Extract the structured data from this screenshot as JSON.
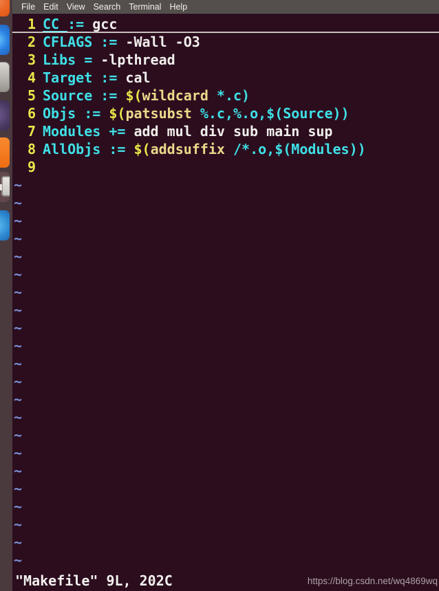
{
  "window": {
    "title": "Makefile - Terminal",
    "background_color": "#2b0d1e",
    "menubar_color": "#544f4c",
    "launcher_color": "#4a3a3e"
  },
  "menubar": {
    "items": [
      {
        "label": "File"
      },
      {
        "label": "Edit"
      },
      {
        "label": "View"
      },
      {
        "label": "Search"
      },
      {
        "label": "Terminal"
      },
      {
        "label": "Help"
      }
    ]
  },
  "launcher": {
    "icons": [
      {
        "name": "ubuntu-dash-icon"
      },
      {
        "name": "firefox-icon"
      },
      {
        "name": "files-icon"
      },
      {
        "name": "software-center-icon"
      },
      {
        "name": "libreoffice-icon"
      },
      {
        "name": "terminal-icon"
      },
      {
        "name": "settings-icon"
      }
    ]
  },
  "editor": {
    "filename": "Makefile",
    "colors": {
      "lineno": "#e8e84a",
      "variable": "#3fe0e6",
      "value": "#f2efec",
      "function_paren": "#e8e84a",
      "function_name": "#ecd98a",
      "tilde": "#7a8fd6"
    },
    "lines": [
      {
        "number": "1",
        "cursorline": true,
        "tokens": [
          {
            "type": "var",
            "text": "CC "
          },
          {
            "type": "op",
            "text": ":="
          },
          {
            "type": "plain",
            "text": " gcc"
          }
        ]
      },
      {
        "number": "2",
        "cursorline": false,
        "tokens": [
          {
            "type": "var",
            "text": "CFLAGS"
          },
          {
            "type": "plain",
            "text": " "
          },
          {
            "type": "op",
            "text": ":="
          },
          {
            "type": "plain",
            "text": " -Wall -O3"
          }
        ]
      },
      {
        "number": "3",
        "cursorline": false,
        "tokens": [
          {
            "type": "var",
            "text": "Libs"
          },
          {
            "type": "plain",
            "text": " "
          },
          {
            "type": "op",
            "text": "="
          },
          {
            "type": "plain",
            "text": " -lpthread"
          }
        ]
      },
      {
        "number": "4",
        "cursorline": false,
        "tokens": [
          {
            "type": "var",
            "text": "Target"
          },
          {
            "type": "plain",
            "text": " "
          },
          {
            "type": "op",
            "text": ":="
          },
          {
            "type": "plain",
            "text": " cal"
          }
        ]
      },
      {
        "number": "5",
        "cursorline": false,
        "tokens": [
          {
            "type": "var",
            "text": "Source"
          },
          {
            "type": "plain",
            "text": " "
          },
          {
            "type": "op",
            "text": ":="
          },
          {
            "type": "plain",
            "text": " "
          },
          {
            "type": "func",
            "text": "$("
          },
          {
            "type": "fname",
            "text": "wildcard"
          },
          {
            "type": "args",
            "text": " *.c)"
          }
        ]
      },
      {
        "number": "6",
        "cursorline": false,
        "tokens": [
          {
            "type": "var",
            "text": "Objs"
          },
          {
            "type": "plain",
            "text": " "
          },
          {
            "type": "op",
            "text": ":="
          },
          {
            "type": "plain",
            "text": " "
          },
          {
            "type": "func",
            "text": "$("
          },
          {
            "type": "fname",
            "text": "patsubst"
          },
          {
            "type": "args",
            "text": " %.c,%.o,$(Source))"
          }
        ]
      },
      {
        "number": "7",
        "cursorline": false,
        "tokens": [
          {
            "type": "var",
            "text": "Modules"
          },
          {
            "type": "plain",
            "text": " "
          },
          {
            "type": "op",
            "text": "+="
          },
          {
            "type": "plain",
            "text": " add mul div sub main sup"
          }
        ]
      },
      {
        "number": "8",
        "cursorline": false,
        "tokens": [
          {
            "type": "var",
            "text": "AllObjs"
          },
          {
            "type": "plain",
            "text": " "
          },
          {
            "type": "op",
            "text": ":="
          },
          {
            "type": "plain",
            "text": " "
          },
          {
            "type": "func",
            "text": "$("
          },
          {
            "type": "fname",
            "text": "addsuffix"
          },
          {
            "type": "args",
            "text": " /*.o,$(Modules))"
          }
        ]
      },
      {
        "number": "9",
        "cursorline": false,
        "tokens": []
      }
    ],
    "tilde_count": 23,
    "tilde_char": "~"
  },
  "statusline": {
    "text": "\"Makefile\" 9L, 202C",
    "watermark": "https://blog.csdn.net/wq4869wq"
  }
}
